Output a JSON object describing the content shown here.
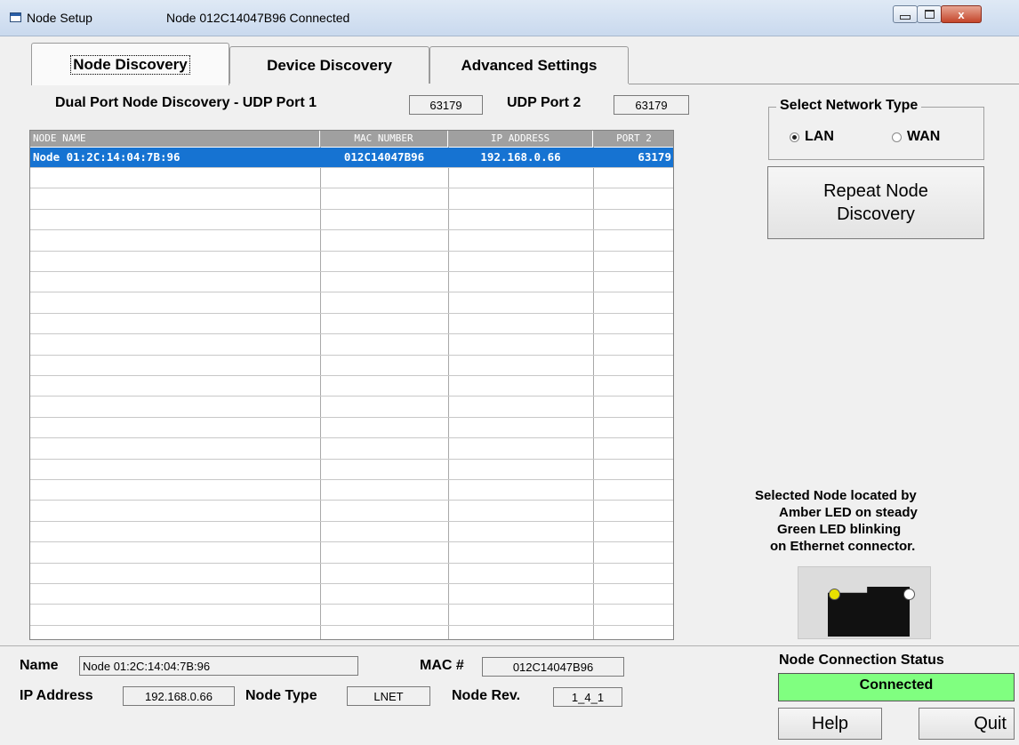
{
  "window": {
    "title": "Node Setup",
    "status": "Node 012C14047B96 Connected",
    "controls": {
      "minimize": "minimize",
      "maximize": "maximize",
      "close": "x"
    }
  },
  "tabs": [
    {
      "label": "Node Discovery",
      "active": true
    },
    {
      "label": "Device Discovery",
      "active": false
    },
    {
      "label": "Advanced Settings",
      "active": false
    }
  ],
  "discovery": {
    "port1_label": "Dual Port Node Discovery - UDP Port 1",
    "port1_value": "63179",
    "port2_label": "UDP Port 2",
    "port2_value": "63179"
  },
  "grid": {
    "columns": [
      "NODE NAME",
      "MAC NUMBER",
      "IP ADDRESS",
      "PORT 2"
    ],
    "rows": [
      {
        "name": "Node 01:2C:14:04:7B:96",
        "mac": "012C14047B96",
        "ip": "192.168.0.66",
        "port": "63179",
        "selected": true
      }
    ]
  },
  "network": {
    "legend": "Select Network Type",
    "options": [
      {
        "label": "LAN",
        "checked": true
      },
      {
        "label": "WAN",
        "checked": false
      }
    ]
  },
  "buttons": {
    "repeat": "Repeat Node Discovery",
    "help": "Help",
    "quit": "Quit"
  },
  "hint": {
    "line1": "Selected Node located by",
    "line2": "Amber LED on steady",
    "line3": "Green LED blinking",
    "line4": "on Ethernet connector."
  },
  "details": {
    "name_label": "Name",
    "name_value": "Node 01:2C:14:04:7B:96",
    "mac_label": "MAC #",
    "mac_value": "012C14047B96",
    "ip_label": "IP Address",
    "ip_value": "192.168.0.66",
    "type_label": "Node Type",
    "type_value": "LNET",
    "rev_label": "Node Rev.",
    "rev_value": "1_4_1"
  },
  "connection": {
    "label": "Node Connection Status",
    "value": "Connected",
    "color": "#80ff80"
  },
  "led_colors": {
    "amber": "#e8e000",
    "green": "#ffffff"
  }
}
